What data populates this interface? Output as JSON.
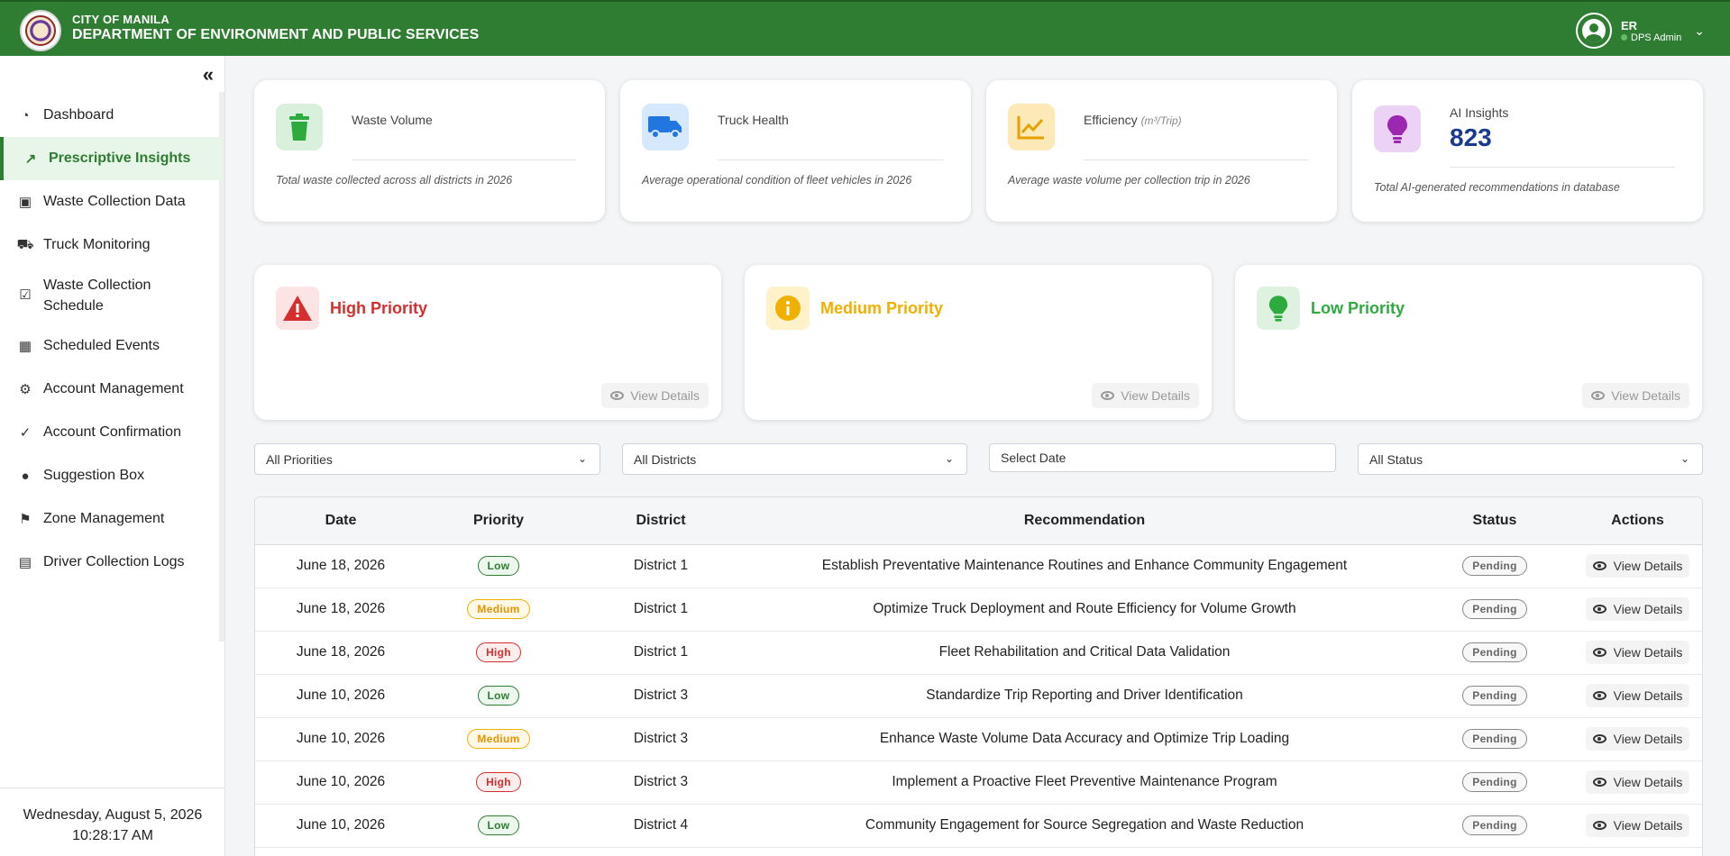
{
  "header": {
    "org_line1": "CITY OF MANILA",
    "org_line2": "DEPARTMENT OF ENVIRONMENT AND PUBLIC SERVICES",
    "user_initials": "ER",
    "user_role": "DPS Admin"
  },
  "sidebar": {
    "items": [
      {
        "label": "Dashboard",
        "icon": "dashboard-icon"
      },
      {
        "label": "Prescriptive Insights",
        "icon": "chart-line-icon"
      },
      {
        "label": "Waste Collection Data",
        "icon": "trash-icon"
      },
      {
        "label": "Truck Monitoring",
        "icon": "truck-icon"
      },
      {
        "label": "Waste Collection Schedule",
        "icon": "calendar-check-icon"
      },
      {
        "label": "Scheduled Events",
        "icon": "calendar-icon"
      },
      {
        "label": "Account Management",
        "icon": "user-gear-icon"
      },
      {
        "label": "Account Confirmation",
        "icon": "user-check-icon"
      },
      {
        "label": "Suggestion Box",
        "icon": "comment-icon"
      },
      {
        "label": "Zone Management",
        "icon": "map-icon"
      },
      {
        "label": "Driver Collection Logs",
        "icon": "clipboard-icon"
      }
    ],
    "date": "Wednesday, August 5, 2026",
    "time": "10:28:17 AM"
  },
  "kpis": {
    "waste": {
      "title": "Waste Volume",
      "desc": "Total waste collected across all districts in 2026"
    },
    "truck": {
      "title": "Truck Health",
      "desc": "Average operational condition of fleet vehicles in 2026"
    },
    "efficiency": {
      "title": "Efficiency",
      "unit": "(m³/Trip)",
      "desc": "Average waste volume per collection trip in 2026"
    },
    "ai": {
      "title": "AI Insights",
      "value": "823",
      "desc": "Total AI-generated recommendations in database"
    }
  },
  "priority_cards": {
    "high": "High Priority",
    "medium": "Medium Priority",
    "low": "Low Priority",
    "view_details": "View Details"
  },
  "filters": {
    "priority": "All Priorities",
    "district": "All Districts",
    "date_placeholder": "Select Date",
    "status": "All Status"
  },
  "table": {
    "headers": [
      "Date",
      "Priority",
      "District",
      "Recommendation",
      "Status",
      "Actions"
    ],
    "rows": [
      {
        "date": "June 18, 2026",
        "priority": "Low",
        "district": "District 1",
        "recommendation": "Establish Preventative Maintenance Routines and Enhance Community Engagement",
        "status": "Pending",
        "action": "View Details"
      },
      {
        "date": "June 18, 2026",
        "priority": "Medium",
        "district": "District 1",
        "recommendation": "Optimize Truck Deployment and Route Efficiency for Volume Growth",
        "status": "Pending",
        "action": "View Details"
      },
      {
        "date": "June 18, 2026",
        "priority": "High",
        "district": "District 1",
        "recommendation": "Fleet Rehabilitation and Critical Data Validation",
        "status": "Pending",
        "action": "View Details"
      },
      {
        "date": "June 10, 2026",
        "priority": "Low",
        "district": "District 3",
        "recommendation": "Standardize Trip Reporting and Driver Identification",
        "status": "Pending",
        "action": "View Details"
      },
      {
        "date": "June 10, 2026",
        "priority": "Medium",
        "district": "District 3",
        "recommendation": "Enhance Waste Volume Data Accuracy and Optimize Trip Loading",
        "status": "Pending",
        "action": "View Details"
      },
      {
        "date": "June 10, 2026",
        "priority": "High",
        "district": "District 3",
        "recommendation": "Implement a Proactive Fleet Preventive Maintenance Program",
        "status": "Pending",
        "action": "View Details"
      },
      {
        "date": "June 10, 2026",
        "priority": "Low",
        "district": "District 4",
        "recommendation": "Community Engagement for Source Segregation and Waste Reduction",
        "status": "Pending",
        "action": "View Details"
      }
    ]
  },
  "colors": {
    "brand_green": "#2e7d32",
    "high": "#d32f2f",
    "medium": "#f0b000",
    "low": "#2e7d32",
    "ai_value": "#1a3a8f"
  }
}
